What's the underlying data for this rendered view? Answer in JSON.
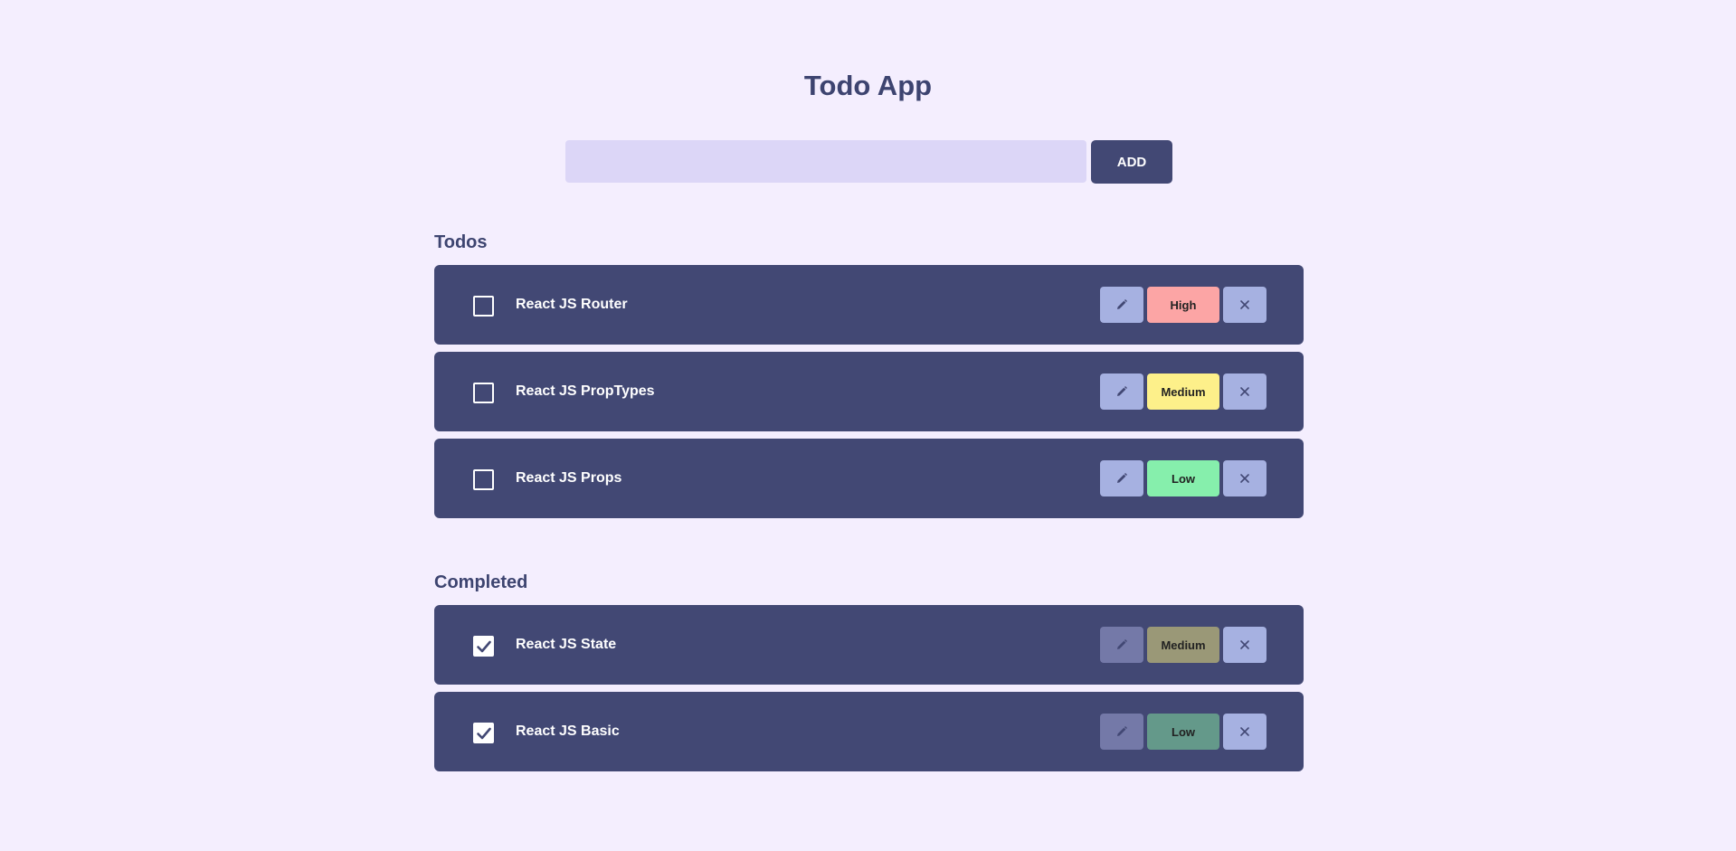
{
  "app": {
    "title": "Todo App"
  },
  "add": {
    "placeholder": "",
    "value": "",
    "button_label": "ADD"
  },
  "sections": {
    "todos": {
      "title": "Todos",
      "items": [
        {
          "text": "React JS Router",
          "priority": "High",
          "checked": false,
          "priority_color": "#fca5a5"
        },
        {
          "text": "React JS PropTypes",
          "priority": "Medium",
          "checked": false,
          "priority_color": "#fdf08a"
        },
        {
          "text": "React JS Props",
          "priority": "Low",
          "checked": false,
          "priority_color": "#86efac"
        }
      ]
    },
    "completed": {
      "title": "Completed",
      "items": [
        {
          "text": "React JS State",
          "priority": "Medium",
          "checked": true,
          "priority_color": "#9a9877"
        },
        {
          "text": "React JS Basic",
          "priority": "Low",
          "checked": true,
          "priority_color": "#64998a"
        }
      ]
    }
  },
  "colors": {
    "background": "#f4eefe",
    "card": "#424874",
    "accent": "#a6b1e1",
    "input": "#dcd6f7"
  },
  "icons": {
    "edit": "pencil-icon",
    "delete": "close-icon",
    "check": "checkmark-icon"
  }
}
